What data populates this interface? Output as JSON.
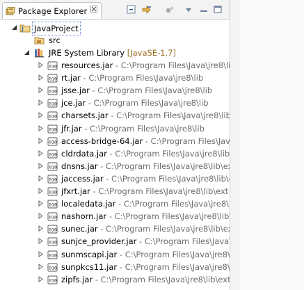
{
  "tab": {
    "title": "Package Explorer",
    "close": "☒"
  },
  "toolbar": {
    "collapse_all": "collapse-all-icon",
    "link_editor": "link-with-editor-icon",
    "menu": "view-menu-icon",
    "minimize": "minimize-icon",
    "maximize": "maximize-icon"
  },
  "tree": {
    "project": "JavaProject",
    "src": "src",
    "library": "JRE System Library",
    "library_decoration": "[JavaSE-1.7]",
    "jars": [
      {
        "name": "resources.jar",
        "path": " - C:\\Program Files\\Java\\jre8\\lib"
      },
      {
        "name": "rt.jar",
        "path": " - C:\\Program Files\\Java\\jre8\\lib"
      },
      {
        "name": "jsse.jar",
        "path": " - C:\\Program Files\\Java\\jre8\\lib"
      },
      {
        "name": "jce.jar",
        "path": " - C:\\Program Files\\Java\\jre8\\lib"
      },
      {
        "name": "charsets.jar",
        "path": " - C:\\Program Files\\Java\\jre8\\lib"
      },
      {
        "name": "jfr.jar",
        "path": " - C:\\Program Files\\Java\\jre8\\lib"
      },
      {
        "name": "access-bridge-64.jar",
        "path": " - C:\\Program Files\\Java\\j"
      },
      {
        "name": "cldrdata.jar",
        "path": " - C:\\Program Files\\Java\\jre8\\lib\\e"
      },
      {
        "name": "dnsns.jar",
        "path": " - C:\\Program Files\\Java\\jre8\\lib\\ext"
      },
      {
        "name": "jaccess.jar",
        "path": " - C:\\Program Files\\Java\\jre8\\lib\\e"
      },
      {
        "name": "jfxrt.jar",
        "path": " - C:\\Program Files\\Java\\jre8\\lib\\ext"
      },
      {
        "name": "localedata.jar",
        "path": " - C:\\Program Files\\Java\\jre8\\lib\\"
      },
      {
        "name": "nashorn.jar",
        "path": " - C:\\Program Files\\Java\\jre8\\lib\\e"
      },
      {
        "name": "sunec.jar",
        "path": " - C:\\Program Files\\Java\\jre8\\lib\\ext"
      },
      {
        "name": "sunjce_provider.jar",
        "path": " - C:\\Program Files\\Java\\jre"
      },
      {
        "name": "sunmscapi.jar",
        "path": " - C:\\Program Files\\Java\\jre8\\lib"
      },
      {
        "name": "sunpkcs11.jar",
        "path": " - C:\\Program Files\\Java\\jre8\\lib"
      },
      {
        "name": "zipfs.jar",
        "path": " - C:\\Program Files\\Java\\jre8\\lib\\ext"
      }
    ]
  },
  "colors": {
    "decoration": "#9a6a1c",
    "path_text": "#6d6d6d",
    "selection_border": "#5a84c6"
  }
}
